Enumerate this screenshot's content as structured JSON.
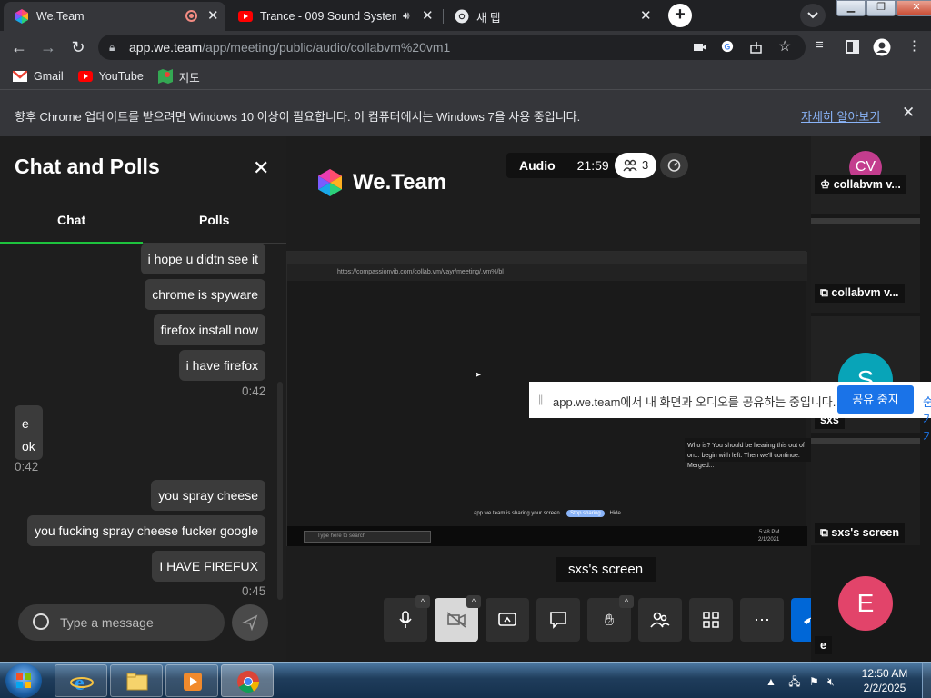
{
  "browser": {
    "tabs": [
      {
        "title": "We.Team",
        "active": true
      },
      {
        "title": "Trance - 009 Sound System D",
        "active": false
      },
      {
        "title": "새 탭",
        "active": false
      }
    ],
    "url_host": "app.we.team",
    "url_path": "/app/meeting/public/audio/collabvm%20vm1",
    "bookmarks": [
      {
        "label": "Gmail"
      },
      {
        "label": "YouTube"
      },
      {
        "label": "지도"
      }
    ],
    "infobar": {
      "message": "향후 Chrome 업데이트를 받으려면 Windows 10 이상이 필요합니다. 이 컴퓨터에서는 Windows 7을 사용 중입니다.",
      "link": "자세히 알아보기"
    },
    "window_buttons": [
      "▁",
      "❐",
      "✕"
    ]
  },
  "chat": {
    "title": "Chat and Polls",
    "tabs": [
      "Chat",
      "Polls"
    ],
    "active_tab": "Chat",
    "messages": [
      {
        "text": "i hope u didtn see it",
        "own": true
      },
      {
        "text": "chrome is spyware",
        "own": true
      },
      {
        "text": "firefox install now",
        "own": true
      },
      {
        "text": "i have firefox",
        "own": true
      },
      {
        "time": "0:42"
      },
      {
        "text": "e",
        "own": false
      },
      {
        "text": "ok",
        "own": false
      },
      {
        "time": "0:42"
      },
      {
        "text": "you spray cheese",
        "own": true
      },
      {
        "text": "you fucking spray cheese fucker google",
        "own": true
      },
      {
        "text": "I HAVE FIREFUX",
        "own": true
      },
      {
        "time": "0:45"
      }
    ],
    "input_placeholder": "Type a message"
  },
  "meeting": {
    "brand": "We.Team",
    "mode": "Audio",
    "elapsed": "21:59",
    "participant_count": "3",
    "shared_screen": {
      "url": "https://compassionvib.com/collab.vm/vayr/meeting/.vm%/bl",
      "tooltip": "Who is? You should be hearing this out of on... begin with left. Then we'll continue. Merged...",
      "share_text": "app.we.team is sharing your screen.",
      "share_btn": "Stop sharing",
      "hide_btn": "Hide",
      "search_placeholder": "Type here to search",
      "clock_time": "5:48 PM",
      "clock_date": "2/1/2021"
    },
    "current_speaker": "sxs's screen",
    "share_notice": {
      "text": "app.we.team에서 내 화면과 오디오를 공유하는 중입니다.",
      "stop_button": "공유 중지",
      "hide_button": "숨기기"
    }
  },
  "participants": [
    {
      "initials": "CV",
      "label": "collabvm v...",
      "host": true,
      "color": "#c33d8e"
    },
    {
      "initials": "",
      "label": "collabvm v...",
      "screen": true
    },
    {
      "initials": "S",
      "label": "sxs",
      "color": "#08a4b8"
    },
    {
      "initials": "",
      "label": "sxs's screen",
      "screen": true
    },
    {
      "initials": "E",
      "label": "e",
      "color": "#e2446a"
    }
  ],
  "taskbar": {
    "time": "12:50 AM",
    "date": "2/2/2025"
  }
}
